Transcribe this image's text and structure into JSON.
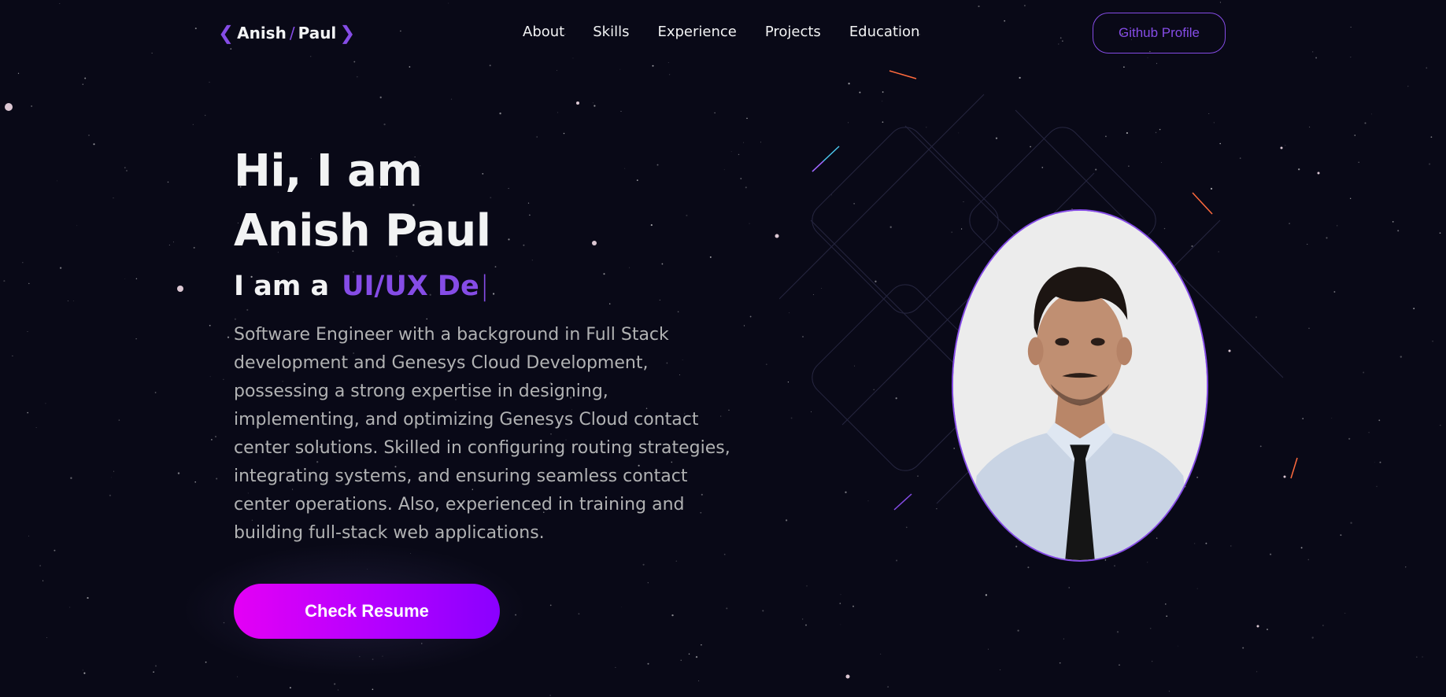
{
  "nav": {
    "logo": {
      "first": "Anish",
      "last": "Paul"
    },
    "links": [
      "About",
      "Skills",
      "Experience",
      "Projects",
      "Education"
    ],
    "github_label": "Github Profile"
  },
  "hero": {
    "title_line1": "Hi, I am",
    "title_line2": "Anish Paul",
    "role_prefix": "I am a",
    "role_typed": "UI/UX De",
    "description": "Software Engineer with a background in Full Stack development and Genesys Cloud Development, possessing a strong expertise in designing, implementing, and optimizing Genesys Cloud contact center solutions. Skilled in configuring routing strategies, integrating systems, and ensuring seamless contact center operations. Also, experienced in training and building full-stack web applications.",
    "cta_label": "Check Resume"
  },
  "colors": {
    "background": "#090917",
    "accent": "#854ce6",
    "text_primary": "#f2f3f4",
    "text_secondary": "#b1b2b3",
    "cta_gradient_start": "#e400f5",
    "cta_gradient_end": "#8a00ff"
  },
  "icons": {
    "logo_left": "chevron-left-icon",
    "logo_right": "chevron-right-icon"
  }
}
